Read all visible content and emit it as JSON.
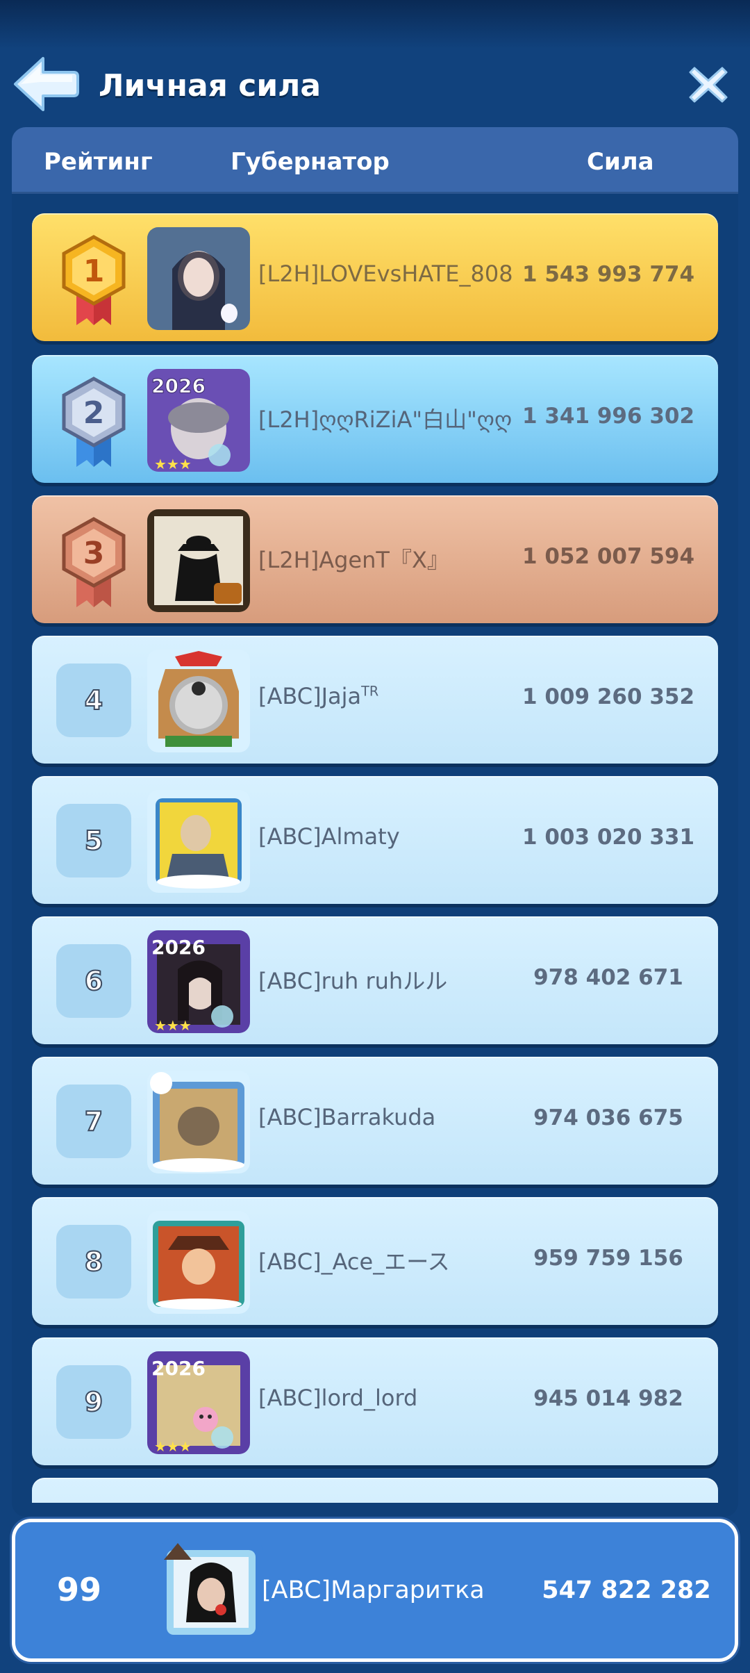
{
  "header": {
    "title": "Личная сила"
  },
  "columns": {
    "rating": "Рейтинг",
    "governor": "Губернатор",
    "power": "Сила"
  },
  "rows": [
    {
      "rank": "1",
      "tier": "gold",
      "name": "[L2H]LOVEvsHATE_808",
      "power": "1 543 993 774"
    },
    {
      "rank": "2",
      "tier": "silver",
      "name": "[L2H]ღღRiZiA\"白山\"ღღ",
      "power": "1 341 996 302"
    },
    {
      "rank": "3",
      "tier": "bronze",
      "name": "[L2H]AgenT『X』",
      "power": "1 052 007 594"
    },
    {
      "rank": "4",
      "tier": "normal",
      "name": "[ABC]Jaja",
      "name_sup": "TR",
      "power": "1 009 260 352"
    },
    {
      "rank": "5",
      "tier": "normal",
      "name": "[ABC]Almaty",
      "power": "1 003 020 331"
    },
    {
      "rank": "6",
      "tier": "normal",
      "name": "[ABC]ruh ruhルル",
      "power": "978 402 671"
    },
    {
      "rank": "7",
      "tier": "normal",
      "name": "[ABC]Barrakuda",
      "power": "974 036 675"
    },
    {
      "rank": "8",
      "tier": "normal",
      "name": "[ABC]_Ace_エース",
      "power": "959 759 156"
    },
    {
      "rank": "9",
      "tier": "normal",
      "name": "[ABC]lord_lord",
      "power": "945 014 982"
    }
  ],
  "me": {
    "rank": "99",
    "name": "[ABC]Маргаритка",
    "power": "547 822 282"
  },
  "avatar_badge": "2026",
  "colors": {
    "gold": "#f2bb3c",
    "silver": "#6bbfef",
    "bronze": "#d79c7c",
    "normal_row": "#cfe9fb",
    "highlight": "#3d82d8",
    "background": "#11427d"
  },
  "icons": {
    "back": "back-arrow-icon",
    "close": "close-x-icon"
  }
}
